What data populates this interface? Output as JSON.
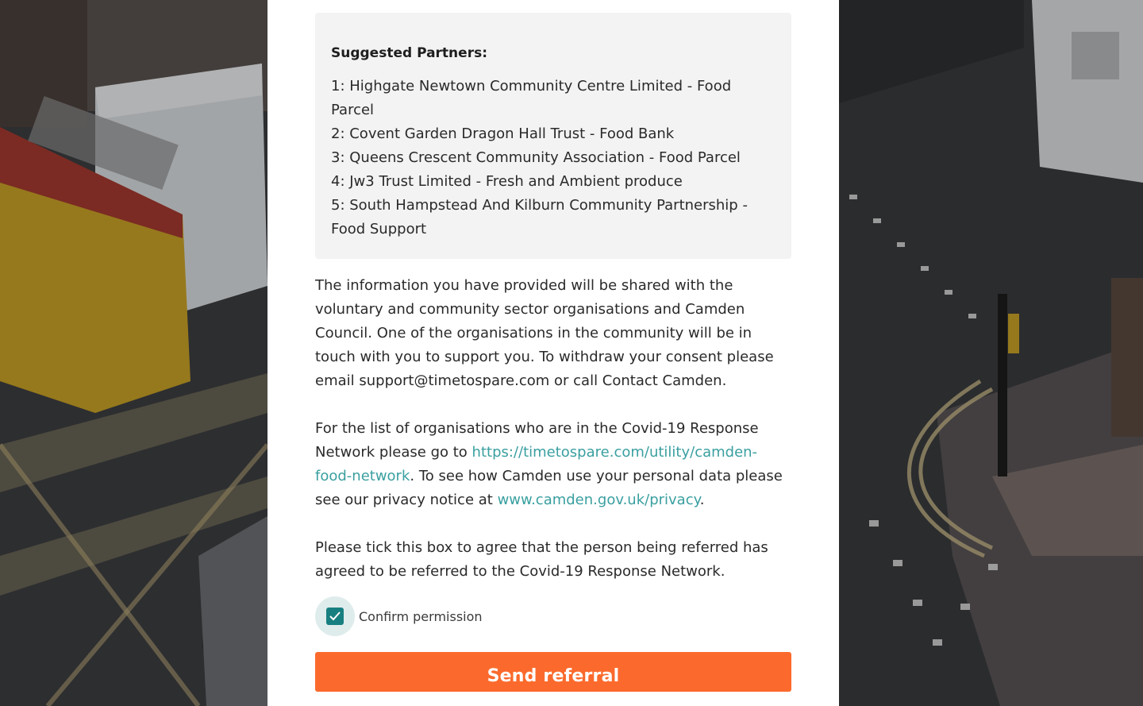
{
  "partners": {
    "title": "Suggested Partners:",
    "items": [
      "1: Highgate Newtown Community Centre Limited - Food Parcel",
      "2: Covent Garden Dragon Hall Trust - Food Bank",
      "3: Queens Crescent Community Association - Food Parcel",
      "4: Jw3 Trust Limited - Fresh and Ambient produce",
      "5: South Hampstead And Kilburn Community Partnership - Food Support"
    ]
  },
  "consent_text": "The information you have provided will be shared with the voluntary and community sector organisations and Camden Council. One of the organisations in the community will be in touch with you to support you. To withdraw your consent please email support@timetospare.com or call Contact Camden.",
  "network_text": {
    "before_link": "For the list of organisations who are in the Covid-19 Response Network please go to ",
    "network_link": "https://timetospare.com/utility/camden-food-network",
    "middle": ". To see how Camden use your personal data please see our privacy notice at ",
    "privacy_link": "www.camden.gov.uk/privacy",
    "after_link": "."
  },
  "agree_text": "Please tick this box to agree that the person being referred has agreed to be referred to the Covid-19 Response Network.",
  "confirm": {
    "label": "Confirm permission",
    "checked": true,
    "checkbox_color": "#187f80"
  },
  "send_button": {
    "label": "Send referral",
    "color": "#fb6a2c"
  },
  "colors": {
    "link": "#3a9fa0",
    "partners_box": "#f3f3f3"
  }
}
